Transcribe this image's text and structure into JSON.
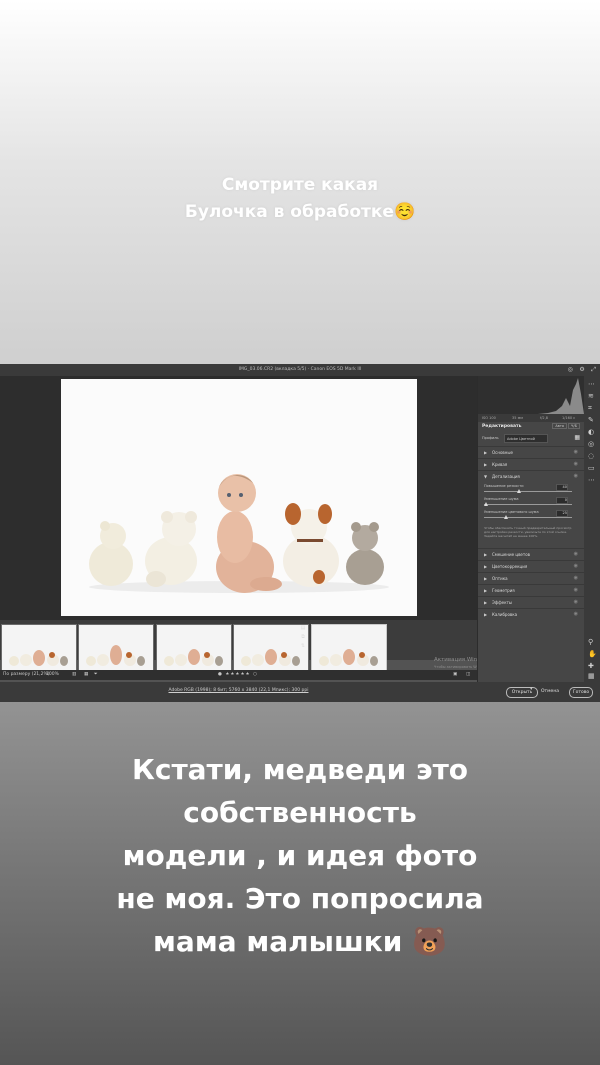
{
  "story": {
    "caption_top": [
      "Смотрите какая",
      "Булочка в обработке☺️"
    ],
    "caption_bottom": [
      "Кстати, медведи это",
      "собственность",
      "модели , и идея фото",
      "не моя. Это попросила",
      "мама малышки 🐻"
    ]
  },
  "camera_raw": {
    "title": "IMG_03.06.CR2 (вкладка 5/5) · Canon EOS 5D Mark III",
    "histogram_info": [
      "ISO 100",
      "35 мм",
      "f/2,8",
      "1/160 с"
    ],
    "edit_heading": "Редактировать",
    "edit_modes": [
      "Авто",
      "Ч/Б"
    ],
    "profile_label": "Профиль",
    "profile_value": "Adobe Цветной",
    "sections_top": [
      "Основные",
      "Кривая"
    ],
    "detail_section": "Детализация",
    "sliders": [
      {
        "label": "Повышение резкости",
        "value": "40",
        "fraction": 0.4
      },
      {
        "label": "Уменьшение шума",
        "value": "0",
        "fraction": 0.02
      },
      {
        "label": "Уменьшение цветового шума",
        "value": "25",
        "fraction": 0.25
      }
    ],
    "detail_note": "Чтобы обеспечить точный предварительный просмотр для настройки резкости, увеличьте по этой ссылке. Задайте масштаб не менее 100%.",
    "sections_bottom": [
      "Смешение цветов",
      "Цветокоррекция",
      "Оптика",
      "Геометрия",
      "Эффекты",
      "Калибровка"
    ],
    "zoom_label": "По размеру (21,2%)",
    "zoom_value": "100%",
    "windows_activation": [
      "Активация Windows",
      "Чтобы активировать Windows, перейдите в раздел \"Параметры\"."
    ],
    "file_info": "Adobe RGB (1998); 8 бит; 5760 x 3840 (22,1 Мпикс); 300 ppi",
    "open_button": "Открыть",
    "cancel_button": "Отмена",
    "done_button": "Готово"
  }
}
